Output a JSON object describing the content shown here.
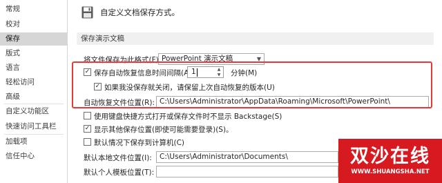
{
  "sidebar": {
    "items": [
      {
        "label": "常规"
      },
      {
        "label": "校对"
      },
      {
        "label": "保存",
        "selected": true
      },
      {
        "label": "版式"
      },
      {
        "label": "语言"
      },
      {
        "label": "轻松访问"
      },
      {
        "label": "高级"
      },
      {
        "label": "自定义功能区"
      },
      {
        "label": "快速访问工具栏"
      },
      {
        "label": "加载项"
      },
      {
        "label": "信任中心"
      }
    ]
  },
  "header": {
    "icon": "save-icon",
    "text": "自定义文档保存方式。"
  },
  "section": {
    "title": "保存演示文稿"
  },
  "save_format": {
    "label": "将文件保存为此格式(F):",
    "value": "PowerPoint 演示文稿"
  },
  "autorecover": {
    "label": "保存自动恢复信息时间间隔(A)",
    "checked": true,
    "minutes": "1",
    "unit": "分钟(M)"
  },
  "keep_last": {
    "label": "如果我没保存就关闭，请保留上次自动恢复的版本(U)",
    "checked": true
  },
  "autorecover_location": {
    "label": "自动恢复文件位置(R):",
    "value": "C:\\Users\\Administrator\\AppData\\Roaming\\Microsoft\\PowerPoint\\"
  },
  "no_backstage": {
    "label": "使用键盘快捷方式打开或保存文件时不显示 Backstage(S)",
    "checked": false
  },
  "show_more_places": {
    "label": "显示其他保存位置(即使可能需要登录)(S)。",
    "checked": true
  },
  "save_to_computer": {
    "label": "默认情况下保存到计算机(C)",
    "checked": false
  },
  "default_local": {
    "label": "默认本地文件位置(I):",
    "value": "C:\\Users\\Administrator\\Documents\\"
  },
  "personal_templates": {
    "label": "默认个人模板位置(T):",
    "value": ""
  },
  "watermark": {
    "title": "双沙在线",
    "url": "WWW.SHUANGSHA.NET"
  },
  "colors": {
    "highlight": "#e53935",
    "watermark_bg": "#d71920",
    "sidebar_selected": "#d6d6d6",
    "section_bg": "#f0f0f0"
  }
}
